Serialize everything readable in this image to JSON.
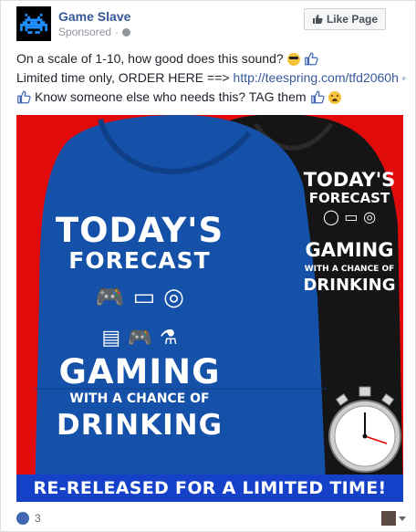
{
  "page": {
    "name": "Game Slave",
    "sponsored": "Sponsored",
    "separator": "·"
  },
  "like_button": {
    "label": "Like Page"
  },
  "post": {
    "line1": "On a scale of 1-10, how good does this sound?",
    "line2_prefix": "Limited time only, ORDER HERE ==>",
    "line2_link": "http://teespring.com/tfd2060h",
    "line3": "Know someone else who needs this? TAG them"
  },
  "image": {
    "front_line1": "TODAY'S",
    "front_line2": "FORECAST",
    "front_line3": "GAMING",
    "front_line4": "WITH A CHANCE OF",
    "front_line5": "DRINKING",
    "back_line1": "TODAY'S",
    "back_line2": "FORECAST",
    "back_line3": "GAMING",
    "back_line4": "WITH A CHANCE OF",
    "back_line5": "DRINKING",
    "banner": "RE-RELEASED FOR A LIMITED TIME!"
  },
  "footer": {
    "reaction_count": "3"
  },
  "colors": {
    "link": "#365899",
    "banner": "#1541c9",
    "image_bg": "#e10b0b",
    "hoodie_blue": "#1551a8"
  },
  "icons": [
    "space-invader-icon",
    "globe-icon",
    "thumbs-up-icon",
    "sunglasses-emoji-icon",
    "worried-emoji-icon",
    "like-reaction-icon",
    "caret-down-icon"
  ]
}
